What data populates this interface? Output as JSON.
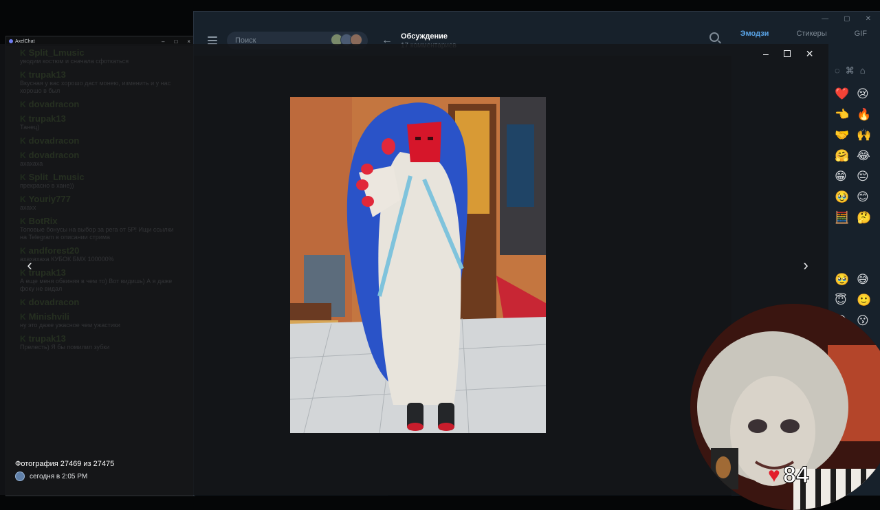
{
  "axelchat": {
    "title": "AxelChat",
    "messages": [
      {
        "user": "Split_Lmusic",
        "text": "уводим костюм и сначала сфоткаться"
      },
      {
        "user": "trupak13",
        "text": "Вкусная у вас хорошо даст монею, изменить и у нас хорошо в был"
      },
      {
        "user": "dovadracon",
        "text": ""
      },
      {
        "user": "trupak13",
        "text": "Танец)"
      },
      {
        "user": "dovadracon",
        "text": ""
      },
      {
        "user": "dovadracon",
        "text": "ахахаха"
      },
      {
        "user": "Split_Lmusic",
        "text": "прекрасно в хане))"
      },
      {
        "user": "Youriy777",
        "text": "ахахх"
      },
      {
        "user": "BotRix",
        "text": "Топовые бонусы на выбор за рега от 5Р! Ищи ссылки на Telegram в описании стрима"
      },
      {
        "user": "andforest20",
        "text": "ахахахаха КУБОК БМХ 100000%"
      },
      {
        "user": "trupak13",
        "text": "А еще меня обвиняя в чем то) Вот видишь) А я даже фоку не видал"
      },
      {
        "user": "dovadracon",
        "text": ""
      },
      {
        "user": "Minishvili",
        "text": "ну это даже ужасное чем ужастики"
      },
      {
        "user": "trupak13",
        "text": "Прелесть) Я бы помилил зубки"
      }
    ]
  },
  "telegram": {
    "search_placeholder": "Поиск",
    "thread_title": "Обсуждение",
    "thread_subtitle": "17 комментариев",
    "tabs": [
      "Эмодзи",
      "Стикеры",
      "GIF"
    ],
    "active_tab": "Эмодзи",
    "emoji_col1": [
      "❤️",
      "👈",
      "🤝",
      "🤗",
      "😁",
      "🥹",
      "🧮",
      "",
      "",
      "🥹",
      "😇",
      "😘"
    ],
    "emoji_col2": [
      "😢",
      "🔥",
      "🙌",
      "😂",
      "😔",
      "😊",
      "🤔",
      "",
      "",
      "😅",
      "🙂",
      "😗"
    ]
  },
  "viewer": {
    "caption": "Фотография 27469 из 27475",
    "date": "сегодня в 2:05 PM"
  },
  "stream": {
    "likes": "84"
  },
  "colors": {
    "accent": "#5aa5e8",
    "heart": "#e31d2a",
    "chat_green": "#7fb14a"
  }
}
